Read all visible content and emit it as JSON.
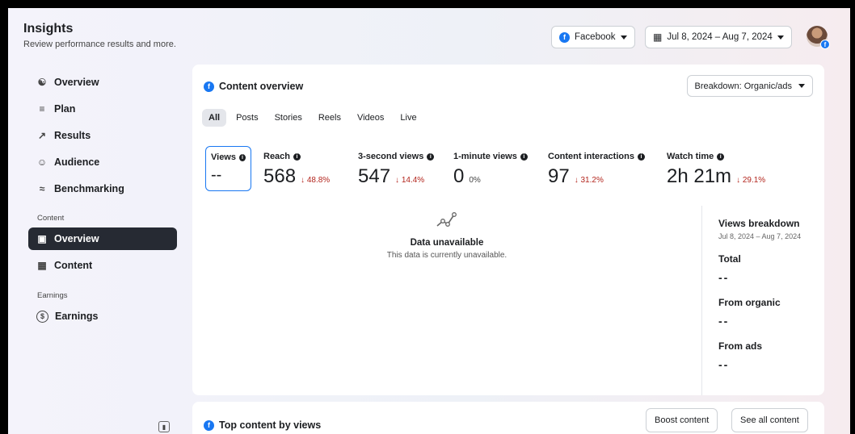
{
  "header": {
    "title": "Insights",
    "subtitle": "Review performance results and more.",
    "platform": "Facebook",
    "date_range": "Jul 8, 2024 – Aug 7, 2024"
  },
  "sidebar": {
    "items": [
      {
        "label": "Overview",
        "icon": "overview-network-icon"
      },
      {
        "label": "Plan",
        "icon": "plan-list-icon"
      },
      {
        "label": "Results",
        "icon": "results-trend-icon"
      },
      {
        "label": "Audience",
        "icon": "audience-people-icon"
      },
      {
        "label": "Benchmarking",
        "icon": "benchmarking-icon"
      }
    ],
    "content_section": "Content",
    "content_items": [
      {
        "label": "Overview",
        "icon": "content-overview-icon",
        "active": true
      },
      {
        "label": "Content",
        "icon": "content-grid-icon"
      }
    ],
    "earnings_section": "Earnings",
    "earnings_items": [
      {
        "label": "Earnings",
        "icon": "dollar-circle-icon"
      }
    ]
  },
  "content_overview": {
    "title": "Content overview",
    "breakdown": "Breakdown: Organic/ads",
    "tabs": [
      "All",
      "Posts",
      "Stories",
      "Reels",
      "Videos",
      "Live"
    ],
    "active_tab": "All",
    "metrics": [
      {
        "label": "Views",
        "value": "--",
        "change": ""
      },
      {
        "label": "Reach",
        "value": "568",
        "change": "↓ 48.8%"
      },
      {
        "label": "3-second views",
        "value": "547",
        "change": "↓ 14.4%"
      },
      {
        "label": "1-minute views",
        "value": "0",
        "change": "0%"
      },
      {
        "label": "Content interactions",
        "value": "97",
        "change": "↓ 31.2%"
      },
      {
        "label": "Watch time",
        "value": "2h 21m",
        "change": "↓ 29.1%"
      }
    ],
    "unavailable": {
      "title": "Data unavailable",
      "subtitle": "This data is currently unavailable."
    },
    "views_breakdown": {
      "title": "Views breakdown",
      "range": "Jul 8, 2024 – Aug 7, 2024",
      "total_label": "Total",
      "total_value": "--",
      "organic_label": "From organic",
      "organic_value": "--",
      "ads_label": "From ads",
      "ads_value": "--"
    }
  },
  "top_content": {
    "title": "Top content by views",
    "boost_label": "Boost content",
    "see_all_label": "See all content"
  },
  "colors": {
    "brand": "#1877f2",
    "negative": "#b3261e",
    "active_nav": "#262a33"
  }
}
